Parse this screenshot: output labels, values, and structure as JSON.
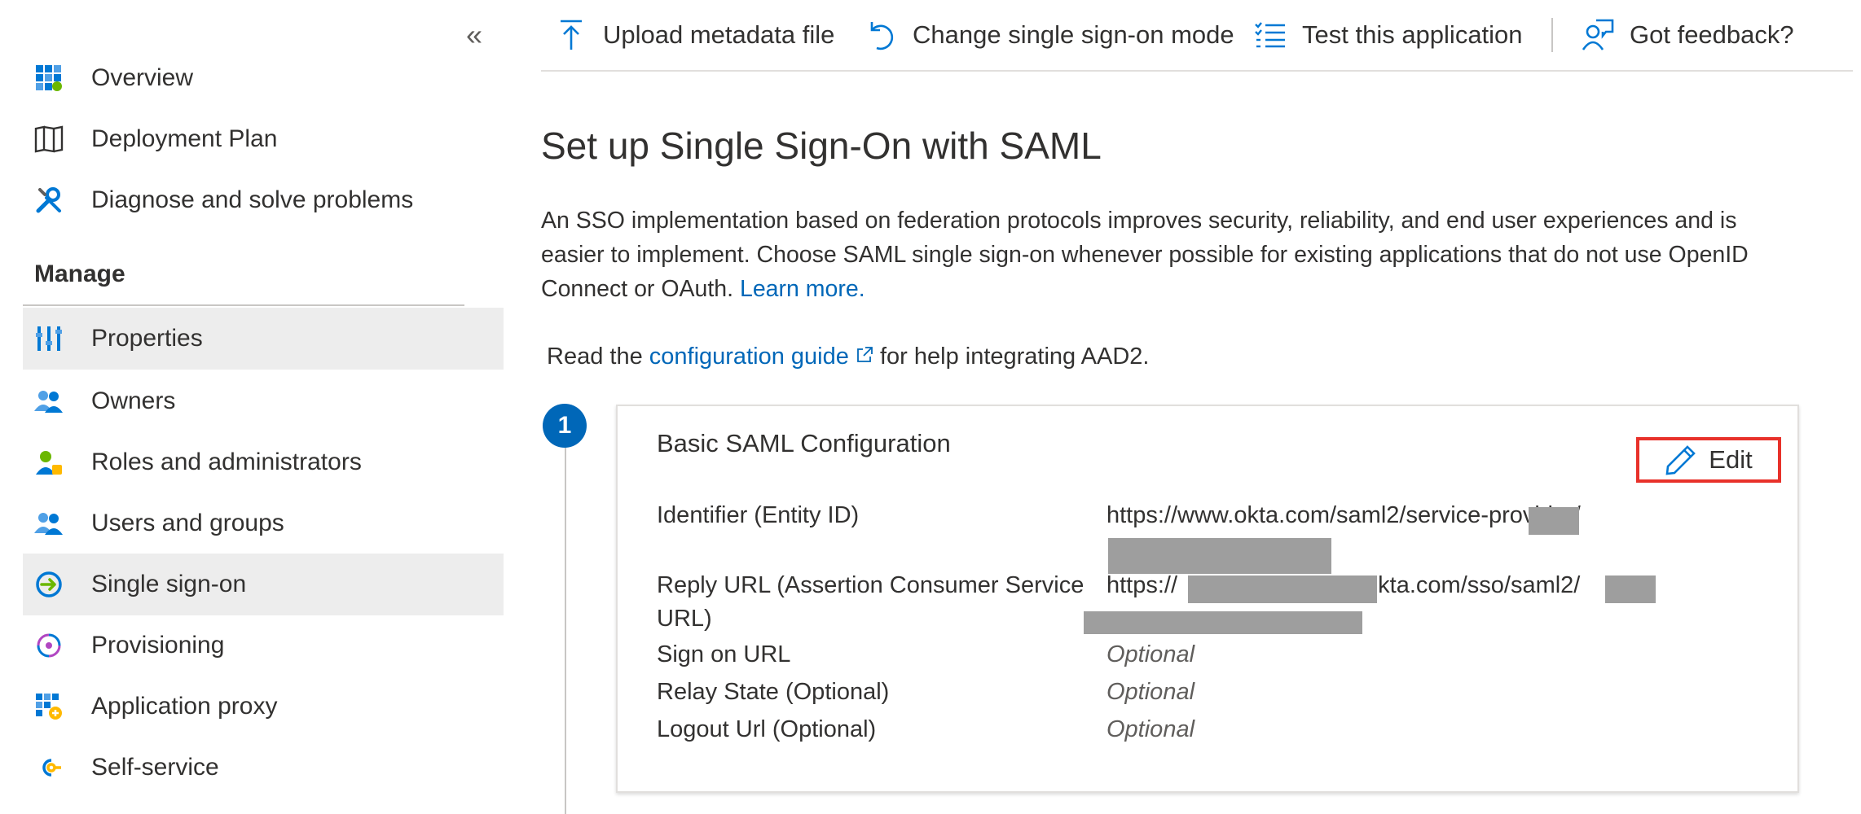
{
  "sidebar": {
    "collapse_label": "«",
    "items_top": [
      {
        "label": "Overview",
        "icon": "grid-icon"
      },
      {
        "label": "Deployment Plan",
        "icon": "book-icon"
      },
      {
        "label": "Diagnose and solve problems",
        "icon": "wrench-icon"
      }
    ],
    "manage_header": "Manage",
    "items_manage": [
      {
        "label": "Properties",
        "icon": "properties-icon"
      },
      {
        "label": "Owners",
        "icon": "owners-icon"
      },
      {
        "label": "Roles and administrators",
        "icon": "roles-icon"
      },
      {
        "label": "Users and groups",
        "icon": "users-icon"
      },
      {
        "label": "Single sign-on",
        "icon": "sso-icon"
      },
      {
        "label": "Provisioning",
        "icon": "provisioning-icon"
      },
      {
        "label": "Application proxy",
        "icon": "app-proxy-icon"
      },
      {
        "label": "Self-service",
        "icon": "self-service-icon"
      }
    ],
    "active_item": "Single sign-on"
  },
  "toolbar": {
    "upload": "Upload metadata file",
    "change_mode": "Change single sign-on mode",
    "test": "Test this application",
    "feedback": "Got feedback?"
  },
  "main": {
    "title": "Set up Single Sign-On with SAML",
    "description_line1": "An SSO implementation based on federation protocols improves security, reliability, and end user experiences and is",
    "description_line2": "easier to implement. Choose SAML single sign-on whenever possible for existing applications that do not use OpenID",
    "description_line3": "Connect or OAuth.",
    "learn_more": "Learn more.",
    "guide_prefix": "Read the",
    "guide_link": "configuration guide",
    "guide_suffix": "for help integrating AAD2."
  },
  "step1": {
    "number": "1",
    "card_title": "Basic SAML Configuration",
    "edit_label": "Edit",
    "identifier_label": "Identifier (Entity ID)",
    "identifier_value": "https://www.okta.com/saml2/service-provider/",
    "reply_label_line1": "Reply URL (Assertion Consumer Service",
    "reply_label_line2": "URL)",
    "reply_value_prefix": "https://",
    "reply_value_suffix": "okta.com/sso/saml2/",
    "sign_on_label": "Sign on URL",
    "sign_on_value": "Optional",
    "relay_label": "Relay State (Optional)",
    "relay_value": "Optional",
    "logout_label": "Logout Url (Optional)",
    "logout_value": "Optional"
  },
  "colors": {
    "accent": "#0067b8",
    "highlight_border": "#e8312a",
    "active_bg": "#ededed",
    "redaction": "#9e9e9e"
  }
}
